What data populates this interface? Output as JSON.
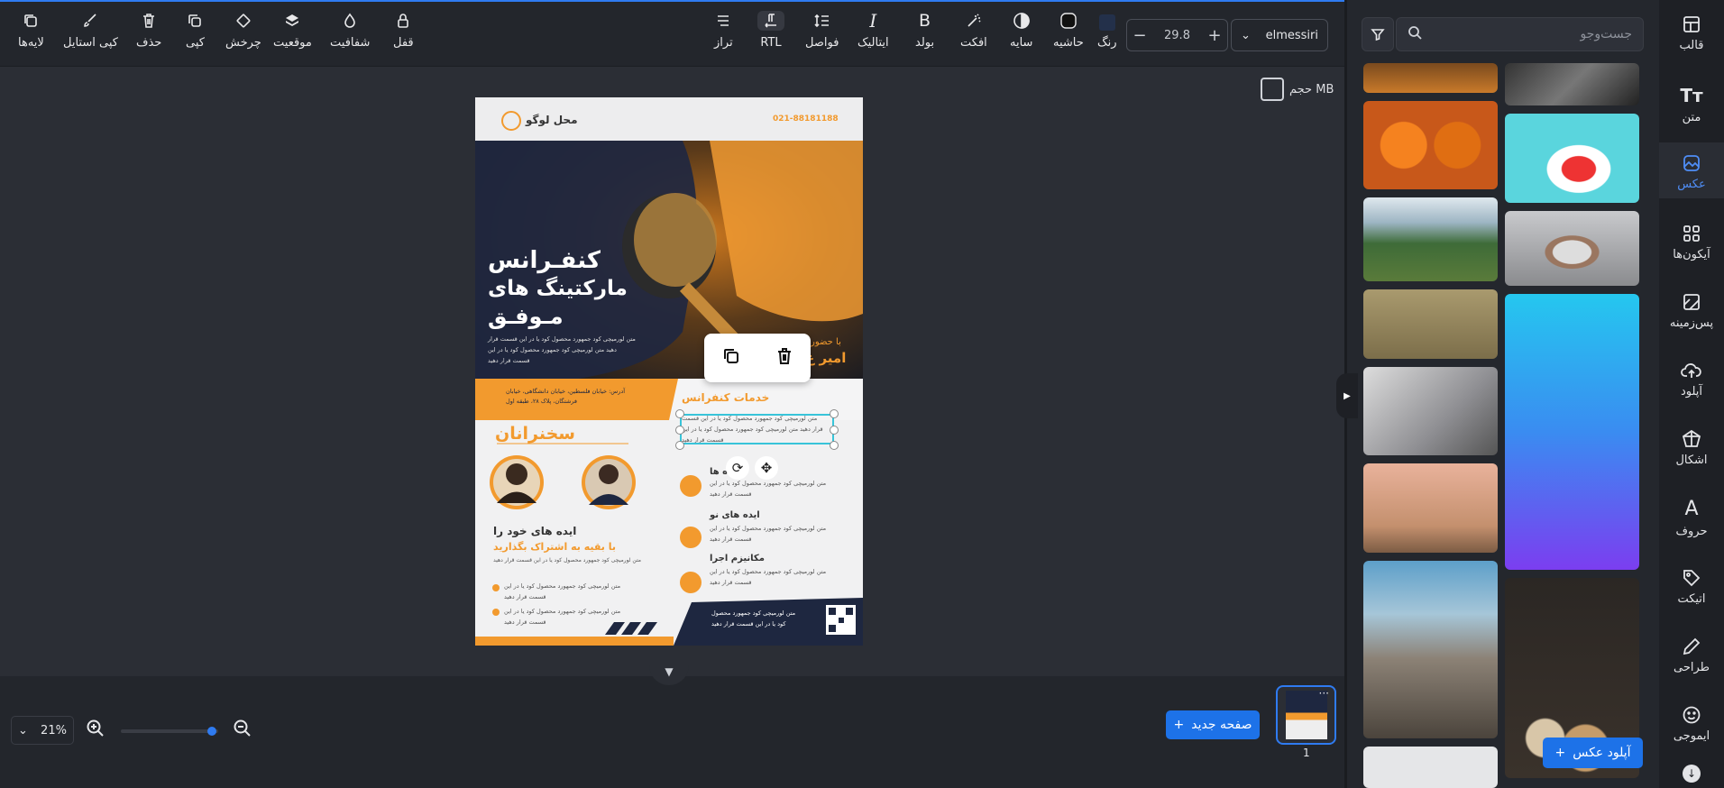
{
  "toolbar": {
    "layers": "لایه‌ها",
    "copy_style": "کپی استایل",
    "delete": "حذف",
    "copy": "کپی",
    "rotate": "چرخش",
    "position": "موقعیت",
    "opacity": "شفافیت",
    "lock": "قفل",
    "align": "تراز",
    "rtl": "RTL",
    "spacing": "فواصل",
    "italic": "ایتالیک",
    "bold": "بولد",
    "effect": "افکت",
    "shadow": "سایه",
    "border": "حاشیه",
    "color": "رنگ",
    "font_size": "29.8",
    "font_name": "elmessiri"
  },
  "canvas": {
    "size_label": "حجم MB"
  },
  "poster": {
    "logo_place": "محل لوگو",
    "phone": "021-88181188",
    "title_1": "کنفـرانس",
    "title_2": "مارکتینگ های",
    "title_3": "مـوفـق",
    "lorem_1": "متن لورمیچی کود جمهورد محصول کود یا در این قسمت قرار",
    "lorem_2": "دهید متن لورمیچی کود جمهورد محصول کود یا در این",
    "lorem_3": "قسمت قرار دهید",
    "presence": "با حضور",
    "presence_name": "امیر ع",
    "address_1": "آدرس: خیابان فلسطین، خیابان دانشگاهی، خیابان",
    "address_2": "فرشتگان، پلاک ۲۸، طبقه اول",
    "services_title": "خدمات کنفرانس",
    "service_text_1": "متن لورمیچی کود جمهورد محصول کود یا در این قسمت",
    "service_text_2": "قرار دهید متن لورمیچی کود جمهورد محصول کود یا در این",
    "service_text_3": "قسمت قرار دهید",
    "speakers": "سخنرانان",
    "feature_1_title": "ایده ها",
    "feature_2_title": "ایده های نو",
    "feature_3_title": "مکانیزم اجرا",
    "feature_text_1": "متن لورمیچی کود جمهورد محصول کود یا در این",
    "feature_text_2": "قسمت قرار دهید",
    "share_1": "ایده های خود را",
    "share_2": "با بقیه به اشتراک بگذارید",
    "share_small": "متن لورمیچی کود جمهورد محصول کود یا در این قسمت قرار دهید",
    "bullet_1": "متن لورمیچی کود جمهورد محصول کود یا در این",
    "bullet_2": "قسمت قرار دهید",
    "footer_1": "متن لورمیچی کود جمهورد محصول",
    "footer_2": "کود یا در این قسمت قرار دهید"
  },
  "bottom": {
    "zoom": "21%",
    "new_page": "صفحه جدید",
    "page_number": "1"
  },
  "panel": {
    "search_placeholder": "جست‌وجو",
    "upload_button": "آپلود عکس"
  },
  "nav": [
    {
      "label": "قالب",
      "icon": "template-icon"
    },
    {
      "label": "متن",
      "icon": "text-icon"
    },
    {
      "label": "عکس",
      "icon": "image-icon"
    },
    {
      "label": "آیکون‌ها",
      "icon": "icons-grid-icon"
    },
    {
      "label": "پس‌زمینه",
      "icon": "background-icon"
    },
    {
      "label": "آپلود",
      "icon": "upload-cloud-icon"
    },
    {
      "label": "اشکال",
      "icon": "shapes-icon"
    },
    {
      "label": "حروف",
      "icon": "letters-icon"
    },
    {
      "label": "اتیکت",
      "icon": "tag-icon"
    },
    {
      "label": "طراحی",
      "icon": "pen-icon"
    },
    {
      "label": "ایموجی",
      "icon": "emoji-icon"
    }
  ],
  "colors": {
    "accent": "#1d72e8",
    "orange": "#f29a2e",
    "navy": "#1e2740"
  }
}
